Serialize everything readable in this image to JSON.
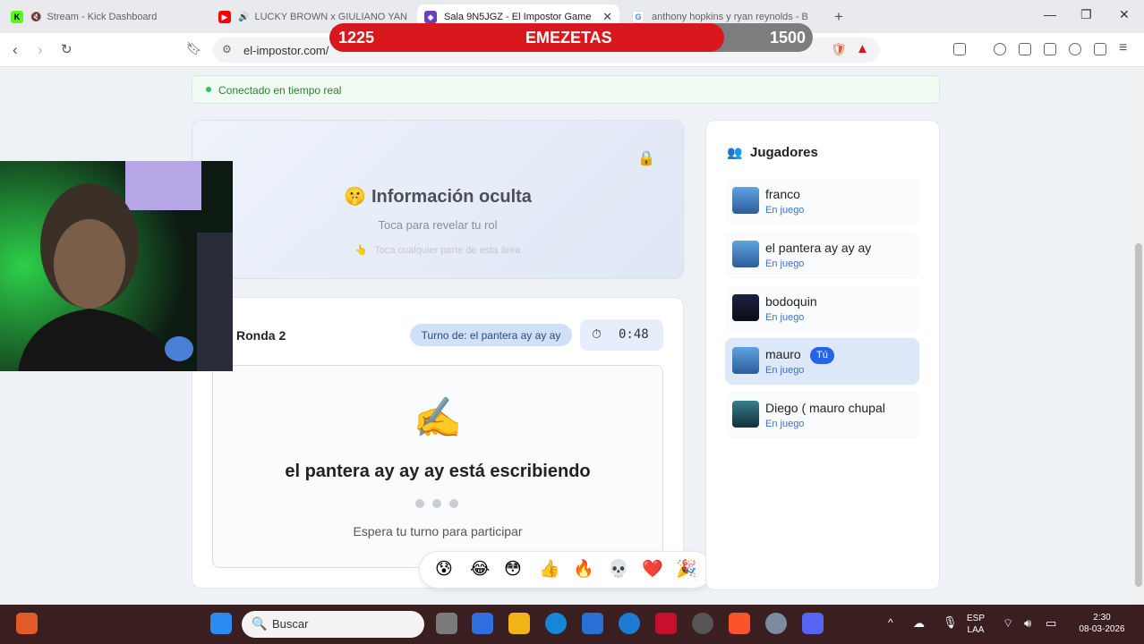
{
  "browser": {
    "tabs": [
      {
        "title": "Stream - Kick Dashboard",
        "favicon": "kick-icon",
        "active": false
      },
      {
        "title": "LUCKY BROWN x GIULIANO YAN",
        "favicon": "youtube-icon",
        "active": false
      },
      {
        "title": "Sala 9N5JGZ - El Impostor Game",
        "favicon": "impostor-icon",
        "active": true
      },
      {
        "title": "anthony hopkins y ryan reynolds - B",
        "favicon": "google-icon",
        "active": false
      }
    ],
    "url": "el-impostor.com/"
  },
  "overlay_banner": {
    "left_score": "1225",
    "title": "EMEZETAS",
    "right_score": "1500",
    "progress_fraction": 0.816
  },
  "status": {
    "text": "Conectado en tiempo real"
  },
  "hidden_info": {
    "title": "Información oculta",
    "subtitle": "Toca para revelar tu rol",
    "hint": "Toca cualquier parte de esta área"
  },
  "round": {
    "title": "Ronda 2",
    "turn_label": "Turno de: el pantera ay ay ay",
    "timer": "0:48",
    "writing_text": "el pantera ay ay ay está escribiendo",
    "wait_text": "Espera tu turno para participar"
  },
  "reactions": [
    "😰",
    "😂",
    "😳",
    "👍",
    "🔥",
    "💀",
    "❤️",
    "🎉"
  ],
  "players": {
    "title": "Jugadores",
    "list": [
      {
        "name": "franco",
        "status": "En juego",
        "is_me": false
      },
      {
        "name": "el pantera ay ay ay",
        "status": "En juego",
        "is_me": false
      },
      {
        "name": "bodoquin",
        "status": "En juego",
        "is_me": false
      },
      {
        "name": "mauro",
        "status": "En juego",
        "is_me": true,
        "badge": "Tú"
      },
      {
        "name": "Diego ( mauro chupal",
        "status": "En juego",
        "is_me": false
      }
    ]
  },
  "taskbar": {
    "search_placeholder": "Buscar",
    "language": "ESP",
    "layout": "LAA",
    "time": "2:30",
    "date": "08-03-2026"
  }
}
